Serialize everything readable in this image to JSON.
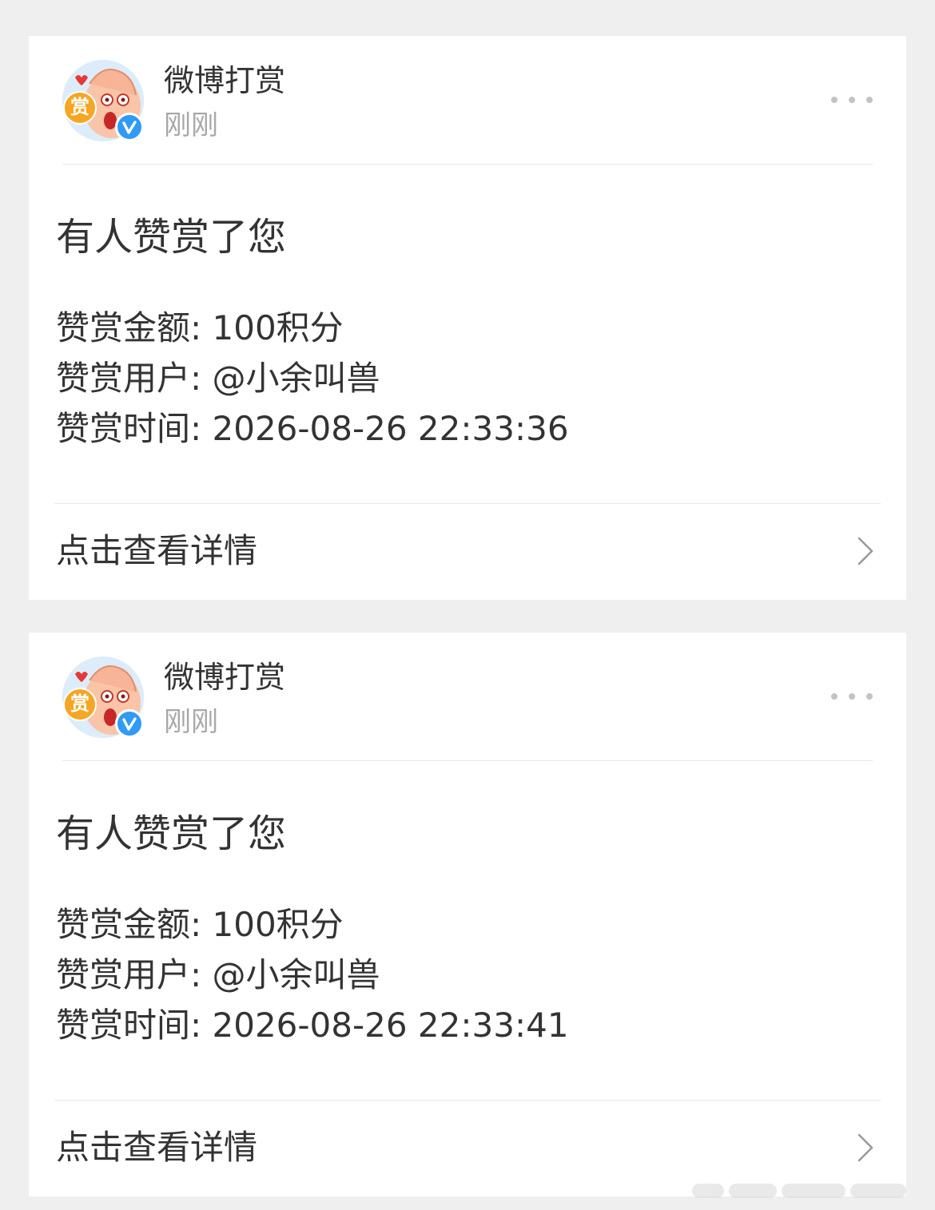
{
  "notifications": [
    {
      "sender": "微博打赏",
      "avatar_badge_text": "赏",
      "time": "刚刚",
      "title": "有人赞赏了您",
      "amount_line": "赞赏金额: 100积分",
      "user_line": "赞赏用户: @小余叫兽",
      "time_line": "赞赏时间: 2026-08-26 22:33:36",
      "link_label": "点击查看详情"
    },
    {
      "sender": "微博打赏",
      "avatar_badge_text": "赏",
      "time": "刚刚",
      "title": "有人赞赏了您",
      "amount_line": "赞赏金额: 100积分",
      "user_line": "赞赏用户: @小余叫兽",
      "time_line": "赞赏时间: 2026-08-26 22:33:41",
      "link_label": "点击查看详情"
    }
  ],
  "icons": {
    "avatar": "mascot-avatar-icon",
    "verified": "verified-v-icon",
    "more": "more-dots-icon",
    "chevron": "chevron-right-icon"
  },
  "colors": {
    "background": "#efefef",
    "card": "#ffffff",
    "text_primary": "#333333",
    "text_secondary": "#a8a8a8",
    "verified_blue": "#2f9bf5",
    "avatar_badge": "#f6a623"
  }
}
